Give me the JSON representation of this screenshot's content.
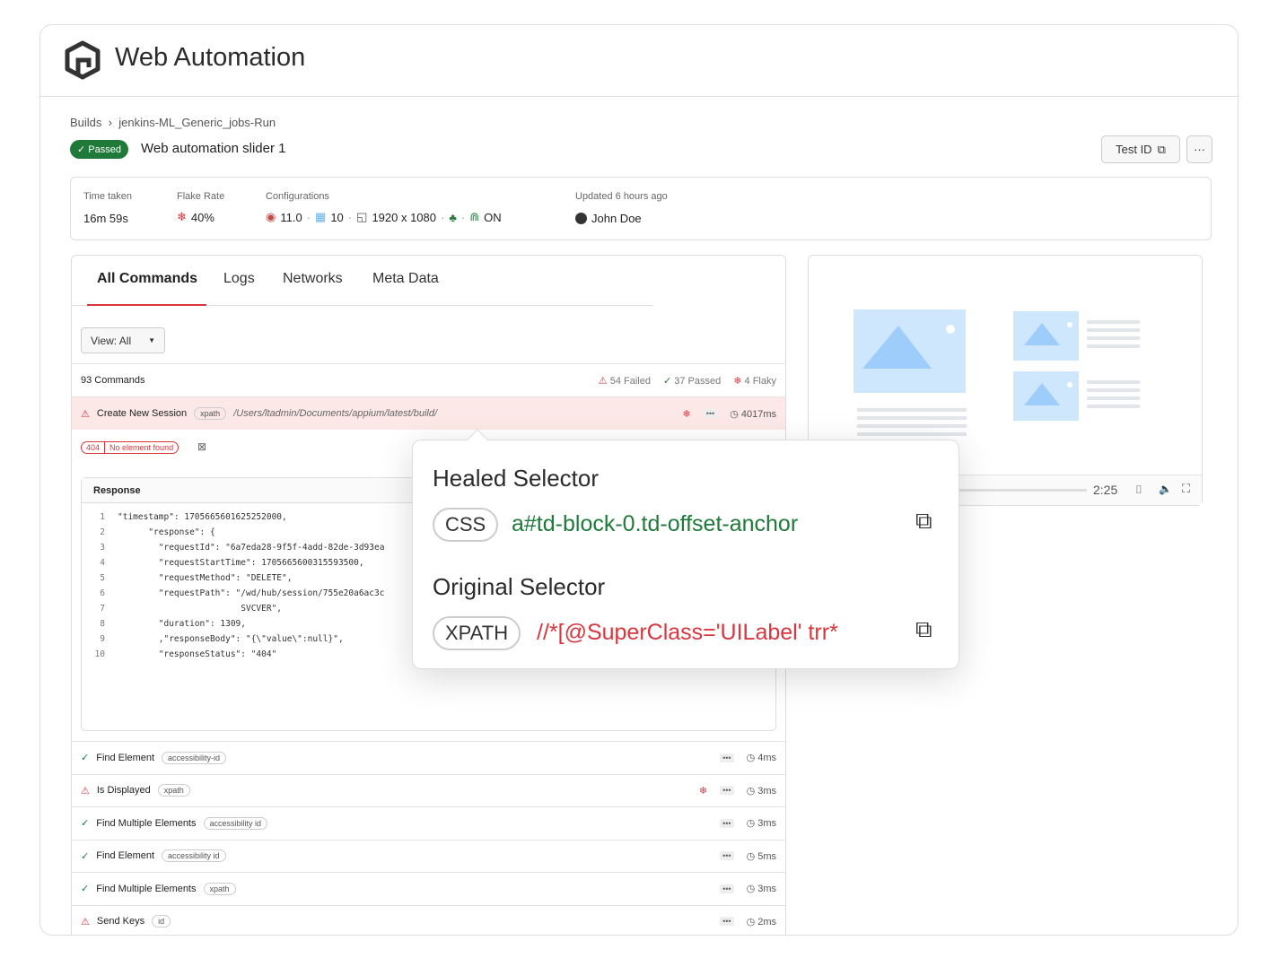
{
  "app": {
    "title": "Web Automation"
  },
  "breadcrumb": {
    "root": "Builds",
    "current": "jenkins-ML_Generic_jobs-Run"
  },
  "test": {
    "status": "Passed",
    "name": "Web automation slider 1",
    "test_id_label": "Test ID",
    "more_label": "···"
  },
  "stats": {
    "time_label": "Time taken",
    "time_value": "16m 59s",
    "flake_label": "Flake Rate",
    "flake_value": "40%",
    "config_label": "Configurations",
    "browser_version": "11.0",
    "os_version": "10",
    "resolution": "1920 x 1080",
    "tunnel": "ON",
    "updated_label": "Updated 6 hours ago",
    "user": "John Doe"
  },
  "tabs": [
    {
      "label": "All Commands"
    },
    {
      "label": "Logs"
    },
    {
      "label": "Networks"
    },
    {
      "label": "Meta Data"
    }
  ],
  "view": {
    "label": "View: All"
  },
  "summary": {
    "count": "93 Commands",
    "failed": "54 Failed",
    "passed": "37 Passed",
    "flaky": "4 Flaky"
  },
  "active_command": {
    "name": "Create New Session",
    "tag": "xpath",
    "path": "/Users/ltadmin/Documents/appium/latest/build/",
    "duration": "4017ms",
    "error_code": "404",
    "error_text": "No element found"
  },
  "response": {
    "title": "Response",
    "lines": [
      "\"timestamp\": 1705665601625252000,",
      "      \"response\": {",
      "        \"requestId\": \"6a7eda28-9f5f-4add-82de-3d93ea",
      "        \"requestStartTime\": 1705665600315593500,",
      "        \"requestMethod\": \"DELETE\",",
      "        \"requestPath\": \"/wd/hub/session/755e20a6ac3c",
      "                        SVCVER\",",
      "        \"duration\": 1309,",
      "        ,\"responseBody\": \"{\\\"value\\\":null}\",",
      "        \"responseStatus\": \"404\""
    ]
  },
  "commands": [
    {
      "status": "passed",
      "name": "Find Element",
      "tag": "accessibility-id",
      "flaky": false,
      "duration": "4ms"
    },
    {
      "status": "failed",
      "name": "Is Displayed",
      "tag": "xpath",
      "flaky": true,
      "duration": "3ms"
    },
    {
      "status": "passed",
      "name": "Find Multiple Elements",
      "tag": "accessibility id",
      "flaky": false,
      "duration": "3ms"
    },
    {
      "status": "passed",
      "name": "Find Element",
      "tag": "accessibility id",
      "flaky": false,
      "duration": "5ms"
    },
    {
      "status": "passed",
      "name": "Find Multiple Elements",
      "tag": "xpath",
      "flaky": false,
      "duration": "3ms"
    },
    {
      "status": "failed",
      "name": "Send Keys",
      "tag": "id",
      "flaky": false,
      "duration": "2ms"
    }
  ],
  "video": {
    "time": "2:25"
  },
  "popup": {
    "healed_title": "Healed Selector",
    "healed_type": "CSS",
    "healed_value": "a#td-block-0.td-offset-anchor",
    "original_title": "Original Selector",
    "original_type": "XPATH",
    "original_value": "//*[@SuperClass='UILabel' trr*"
  },
  "colors": {
    "passed": "#1f7a3a",
    "failed": "#d9363e",
    "healed": "#1f7a3a",
    "original": "#d9363e",
    "flaky": "#d9363e"
  }
}
